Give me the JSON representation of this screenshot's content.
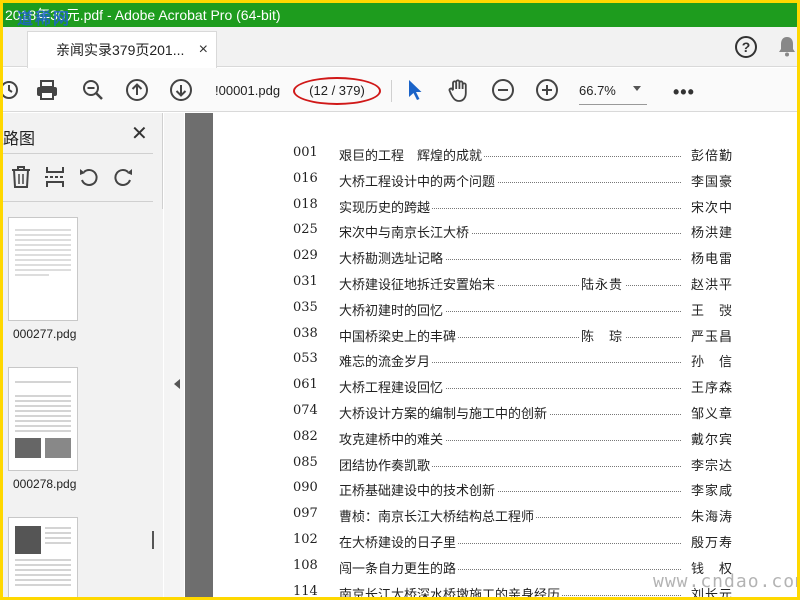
{
  "window": {
    "title": "2018年30元.pdf - Adobe Acrobat Pro (64-bit)",
    "watermark_top": "道稀网"
  },
  "tabbar": {
    "tab_label": "亲闻实录379页201...",
    "tab_close": "×",
    "help_glyph": "?",
    "bell_glyph": "🔔"
  },
  "toolbar": {
    "page_field": "!00001.pdg",
    "page_count": "(12 / 379)",
    "zoom": "66.7%",
    "more": "•••"
  },
  "sidebar": {
    "title": "路图",
    "close": "✕",
    "thumbnails": [
      {
        "label": "000277.pdg"
      },
      {
        "label": "000278.pdg"
      }
    ]
  },
  "toc": [
    {
      "num": "001",
      "title": "艰巨的工程　辉煌的成就",
      "author": "彭倍勤"
    },
    {
      "num": "016",
      "title": "大桥工程设计中的两个问题",
      "author": "李国豪"
    },
    {
      "num": "018",
      "title": "实现历史的跨越",
      "author": "宋次中"
    },
    {
      "num": "025",
      "title": "宋次中与南京长江大桥",
      "author": "杨洪建"
    },
    {
      "num": "029",
      "title": "大桥勘测选址记略",
      "author": "杨电雷"
    },
    {
      "num": "031",
      "title": "大桥建设征地拆迁安置始末",
      "mid": "陆永贵",
      "author": "赵洪平"
    },
    {
      "num": "035",
      "title": "大桥初建时的回忆",
      "author": "王　弢"
    },
    {
      "num": "038",
      "title": "中国桥梁史上的丰碑",
      "mid": "陈　琮",
      "author": "严玉昌"
    },
    {
      "num": "053",
      "title": "难忘的流金岁月",
      "author": "孙　信"
    },
    {
      "num": "061",
      "title": "大桥工程建设回忆",
      "author": "王序森"
    },
    {
      "num": "074",
      "title": "大桥设计方案的编制与施工中的创新",
      "author": "邹义章"
    },
    {
      "num": "082",
      "title": "攻克建桥中的难关",
      "author": "戴尔宾"
    },
    {
      "num": "085",
      "title": "团结协作奏凯歌",
      "author": "李宗达"
    },
    {
      "num": "090",
      "title": "正桥基础建设中的技术创新",
      "author": "李家咸"
    },
    {
      "num": "097",
      "title": "曹桢：南京长江大桥结构总工程师",
      "author": "朱海涛"
    },
    {
      "num": "102",
      "title": "在大桥建设的日子里",
      "author": "殷万寿"
    },
    {
      "num": "108",
      "title": "闯一条自力更生的路",
      "author": "钱　权"
    },
    {
      "num": "114",
      "title": "南京长江大桥深水桥墩施工的亲身经历",
      "author": "刘长元"
    }
  ],
  "watermark_bottom": "www.cndao.com"
}
